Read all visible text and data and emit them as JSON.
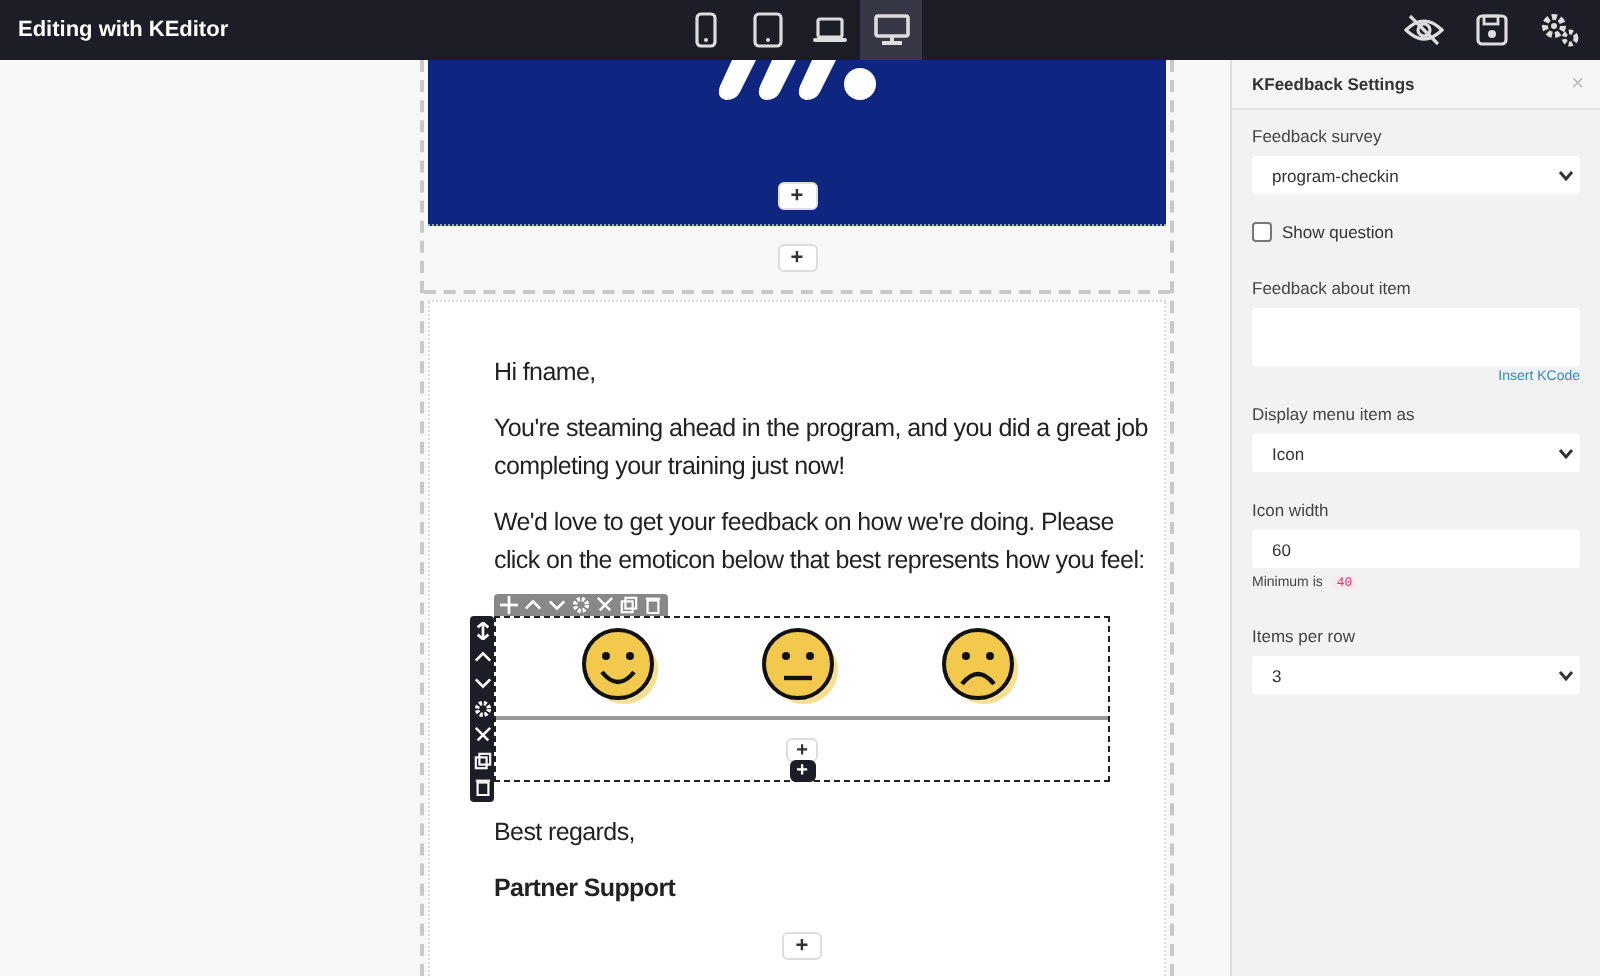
{
  "topbar": {
    "title": "Editing with KEditor",
    "devices": [
      {
        "kind": "phone",
        "selected": false
      },
      {
        "kind": "tablet",
        "selected": false
      },
      {
        "kind": "laptop",
        "selected": false
      },
      {
        "kind": "desktop",
        "selected": true
      }
    ]
  },
  "email": {
    "header_add": "+",
    "between_add": "+",
    "greeting": "Hi fname,",
    "paragraphs": [
      "You're steaming ahead in the program, and you did a great job completing your training just now!",
      "We'd love to get your feedback on how we're doing. Please click on the emoticon below that best represents how you feel:"
    ],
    "feedback": {
      "faces": [
        {
          "kind": "happy"
        },
        {
          "kind": "neutral"
        },
        {
          "kind": "sad"
        }
      ],
      "add": "+",
      "add_dark": "+"
    },
    "regards": "Best regards,",
    "signature": "Partner Support",
    "footer_add": "+"
  },
  "panel": {
    "title": "KFeedback Settings",
    "close": "×",
    "survey_label": "Feedback survey",
    "survey_value": "program-checkin",
    "show_question": {
      "label": "Show question",
      "checked": false
    },
    "about_label": "Feedback about item",
    "insert_link": "Insert KCode",
    "display_label": "Display menu item as",
    "display_value": "Icon",
    "width_label": "Icon width",
    "width_value": "60",
    "minimum_text": "Minimum is",
    "minimum_value": "40",
    "per_row_label": "Items per row",
    "per_row_value": "3"
  }
}
